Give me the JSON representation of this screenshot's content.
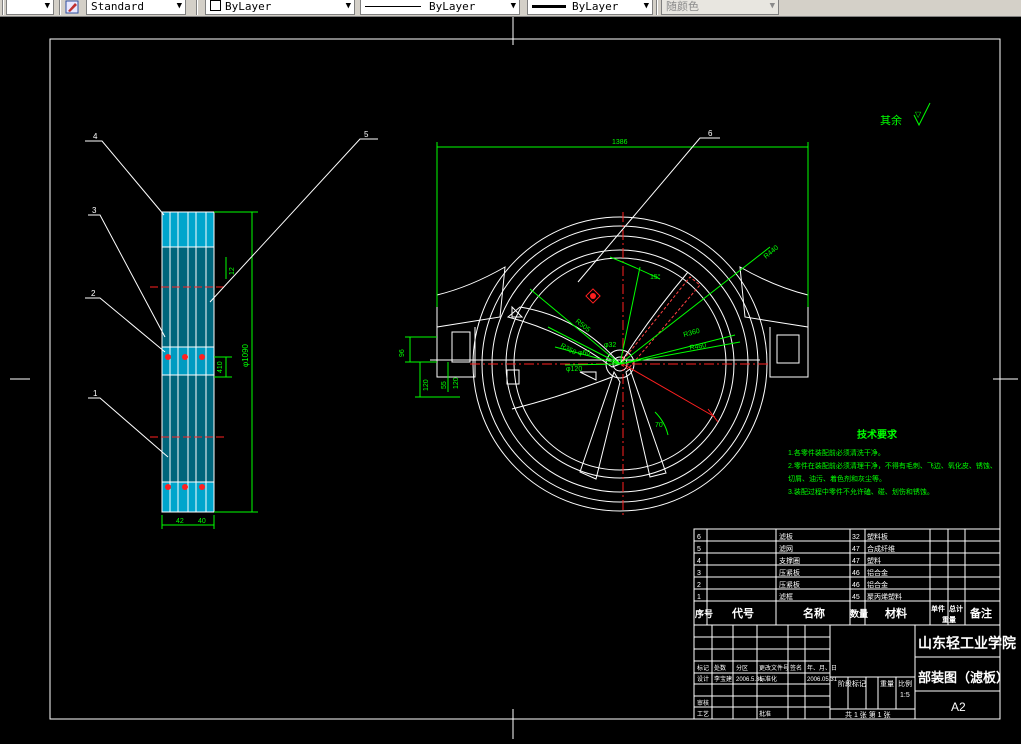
{
  "toolbar": {
    "text_style": "Standard",
    "layer_color": "ByLayer",
    "linetype": "ByLayer",
    "lineweight": "ByLayer",
    "plot_style": "随颜色"
  },
  "drawing": {
    "roughness_label": "其余",
    "tech_req_title": "技术要求",
    "tech_req_lines": [
      "1.各零件装配前必须清洗干净。",
      "2.零件在装配前必须清理干净，不得有毛刺、飞边、氧化皮、锈蚀、",
      "切屑、油污、着色剂和灰尘等。",
      "3.装配过程中零件不允许磕、碰、划伤和锈蚀。"
    ],
    "callouts": [
      "4",
      "3",
      "2",
      "1",
      "5",
      "6"
    ],
    "dims": {
      "overall_width": "1386",
      "side_height": "φ1090",
      "side_small": "12",
      "side_mid": "410",
      "side_w1": "42",
      "side_w2": "40",
      "r_a": "R505",
      "r_b": "R350",
      "r_c": "R360",
      "r_d": "R460",
      "r_e": "R440",
      "r_f": "φ120",
      "r_g": "φ60",
      "r_h": "φ32",
      "ang_a": "15°",
      "ang_b": "70",
      "left_h1": "96",
      "left_h2": "120",
      "left_h3": "55",
      "left_h4": "120"
    }
  },
  "bom": {
    "headers": {
      "seq": "序号",
      "code": "代号",
      "name": "名称",
      "qty": "数量",
      "material": "材料",
      "unit_weight": "单件",
      "total_weight": "总计",
      "weight": "重量",
      "remark": "备注"
    },
    "rows": [
      {
        "seq": "6",
        "name": "滤板",
        "qty": "32",
        "material": "塑料板"
      },
      {
        "seq": "5",
        "name": "滤网",
        "qty": "47",
        "material": "合成纤维"
      },
      {
        "seq": "4",
        "name": "支撑圈",
        "qty": "47",
        "material": "塑料"
      },
      {
        "seq": "3",
        "name": "压紧板",
        "qty": "46",
        "material": "铝合金"
      },
      {
        "seq": "2",
        "name": "压紧板",
        "qty": "46",
        "material": "铝合金"
      },
      {
        "seq": "1",
        "name": "滤框",
        "qty": "45",
        "material": "聚丙烯塑料"
      }
    ]
  },
  "title_block": {
    "school": "山东轻工业学院",
    "drawing_name": "部装图（滤板）",
    "sheet_size": "A2",
    "scale": "1:5",
    "stage_label": "阶段标记",
    "weight_label": "重量",
    "scale_label": "比例",
    "sheet_info": "共 1 张  第 1 张",
    "rows": [
      {
        "a": "标记",
        "b": "处数",
        "c": "分区",
        "d": "更改文件号",
        "e": "签名",
        "f": "年、月、日"
      },
      {
        "a": "设计",
        "b": "李宝建",
        "c": "2006.5.31",
        "d": "标准化",
        "e": "",
        "f": "2006.05.31"
      },
      {
        "a": "审核",
        "b": "",
        "c": "",
        "d": "",
        "e": "",
        "f": ""
      },
      {
        "a": "工艺",
        "b": "",
        "c": "",
        "d": "批准",
        "e": "",
        "f": ""
      }
    ]
  }
}
